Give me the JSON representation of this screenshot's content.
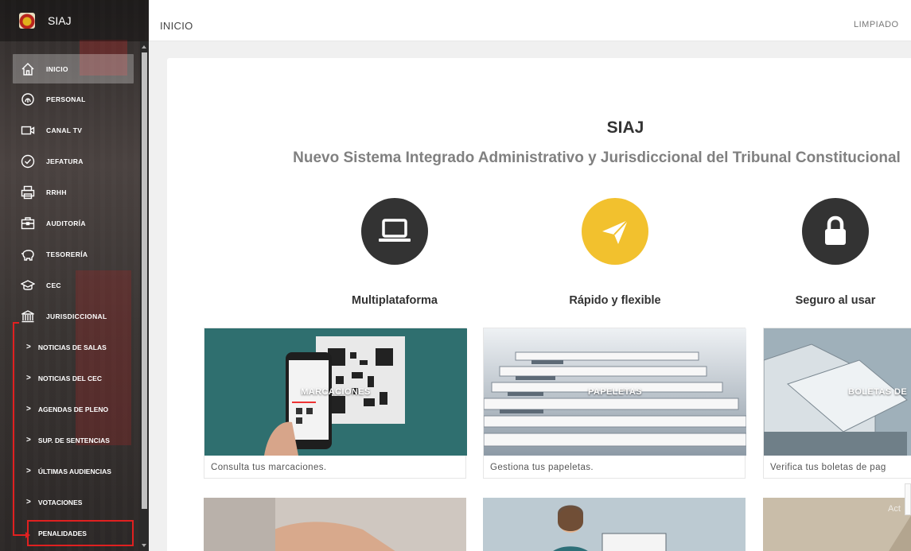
{
  "app": {
    "title": "SIAJ"
  },
  "topbar": {
    "page_title": "INICIO",
    "right_link": "LIMPIADO"
  },
  "sidebar": {
    "items": [
      {
        "label": "INICIO",
        "icon": "home-icon"
      },
      {
        "label": "PERSONAL",
        "icon": "fingerprint-icon"
      },
      {
        "label": "CANAL TV",
        "icon": "video-icon"
      },
      {
        "label": "JEFATURA",
        "icon": "check-circle-icon"
      },
      {
        "label": "RRHH",
        "icon": "printer-icon"
      },
      {
        "label": "AUDITORÍA",
        "icon": "briefcase-icon"
      },
      {
        "label": "TESORERÍA",
        "icon": "piggy-bank-icon"
      },
      {
        "label": "CEC",
        "icon": "graduation-cap-icon"
      },
      {
        "label": "JURISDICCIONAL",
        "icon": "institution-icon"
      }
    ],
    "subitems": [
      {
        "label": "NOTICIAS DE SALAS"
      },
      {
        "label": "NOTICIAS DEL CEC"
      },
      {
        "label": "AGENDAS DE PLENO"
      },
      {
        "label": "SUP. DE SENTENCIAS"
      },
      {
        "label": "ÚLTIMAS AUDIENCIAS"
      },
      {
        "label": "VOTACIONES"
      },
      {
        "label": "PENALIDADES"
      }
    ]
  },
  "hero": {
    "title": "SIAJ",
    "subtitle": "Nuevo Sistema Integrado Administrativo y Jurisdiccional del Tribunal Constitucional"
  },
  "features": [
    {
      "label": "Multiplataforma",
      "icon": "laptop-icon",
      "color": "#333333"
    },
    {
      "label": "Rápido y flexible",
      "icon": "paper-plane-icon",
      "color": "#f2c12e"
    },
    {
      "label": "Seguro al usar",
      "icon": "lock-icon",
      "color": "#333333"
    }
  ],
  "tiles": [
    {
      "title": "MARCACIONES",
      "caption": "Consulta tus marcaciones."
    },
    {
      "title": "PAPELETAS",
      "caption": "Gestiona tus papeletas."
    },
    {
      "title": "BOLETAS DE",
      "caption": "Verifica tus boletas de pag"
    }
  ],
  "watermark": "Act"
}
